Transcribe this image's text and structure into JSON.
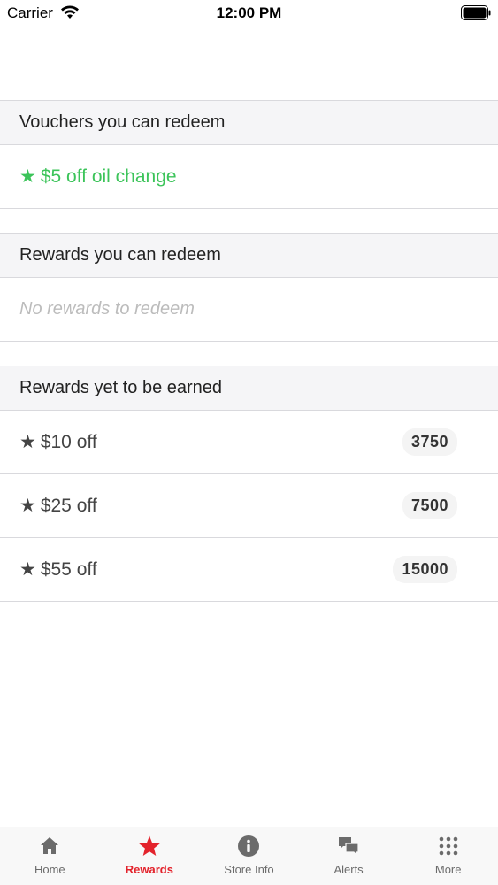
{
  "status_bar": {
    "carrier": "Carrier",
    "time": "12:00 PM"
  },
  "sections": {
    "vouchers": {
      "header": "Vouchers you can redeem",
      "items": [
        {
          "star": "★",
          "label": "$5 off oil change"
        }
      ]
    },
    "rewards_redeem": {
      "header": "Rewards you can redeem",
      "empty_text": "No rewards to redeem"
    },
    "rewards_earn": {
      "header": "Rewards yet to be earned",
      "items": [
        {
          "star": "★",
          "label": "$10 off",
          "points": "3750"
        },
        {
          "star": "★",
          "label": "$25 off",
          "points": "7500"
        },
        {
          "star": "★",
          "label": "$55 off",
          "points": "15000"
        }
      ]
    }
  },
  "tab_bar": {
    "tabs": [
      {
        "label": "Home",
        "icon": "home-icon"
      },
      {
        "label": "Rewards",
        "icon": "star-icon",
        "active": true
      },
      {
        "label": "Store Info",
        "icon": "info-icon"
      },
      {
        "label": "Alerts",
        "icon": "chat-bubbles-icon"
      },
      {
        "label": "More",
        "icon": "grid-dots-icon"
      }
    ]
  },
  "colors": {
    "accent": "#e3232c",
    "voucher_green": "#3cc45a",
    "icon_gray": "#6b6b6b"
  }
}
